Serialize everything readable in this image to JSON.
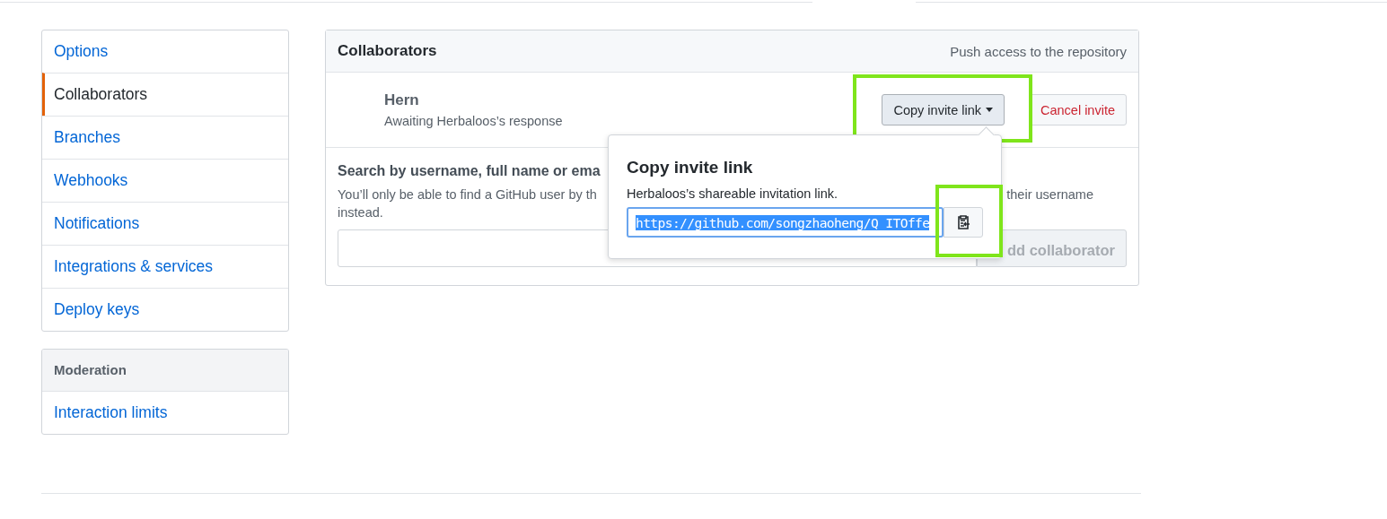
{
  "sidebar": {
    "items": [
      {
        "label": "Options",
        "selected": false
      },
      {
        "label": "Collaborators",
        "selected": true
      },
      {
        "label": "Branches",
        "selected": false
      },
      {
        "label": "Webhooks",
        "selected": false
      },
      {
        "label": "Notifications",
        "selected": false
      },
      {
        "label": "Integrations & services",
        "selected": false
      },
      {
        "label": "Deploy keys",
        "selected": false
      }
    ]
  },
  "moderation": {
    "title": "Moderation",
    "items": [
      {
        "label": "Interaction limits",
        "selected": false
      }
    ]
  },
  "collaborators": {
    "title": "Collaborators",
    "subtitle": "Push access to the repository",
    "invites": [
      {
        "name": "Hern",
        "status": "Awaiting Herbaloos’s response",
        "copy_button": {
          "label": "Copy invite link",
          "highlighted": true
        },
        "cancel_button": "Cancel invite"
      }
    ],
    "search": {
      "label": "Search by username, full name or ema",
      "hint_start": "You’ll only be able to find a GitHub user by th",
      "hint_end": "their username",
      "hint_line_2": "instead.",
      "button": {
        "label": "dd collaborator",
        "disabled": true
      }
    }
  },
  "popover": {
    "title": "Copy invite link",
    "description": "Herbaloos’s shareable invitation link.",
    "link": {
      "value": "https://github.com/songzhaoheng/Q_ITOffe",
      "text_selected": true
    },
    "copy_button": {
      "highlighted": true
    }
  }
}
